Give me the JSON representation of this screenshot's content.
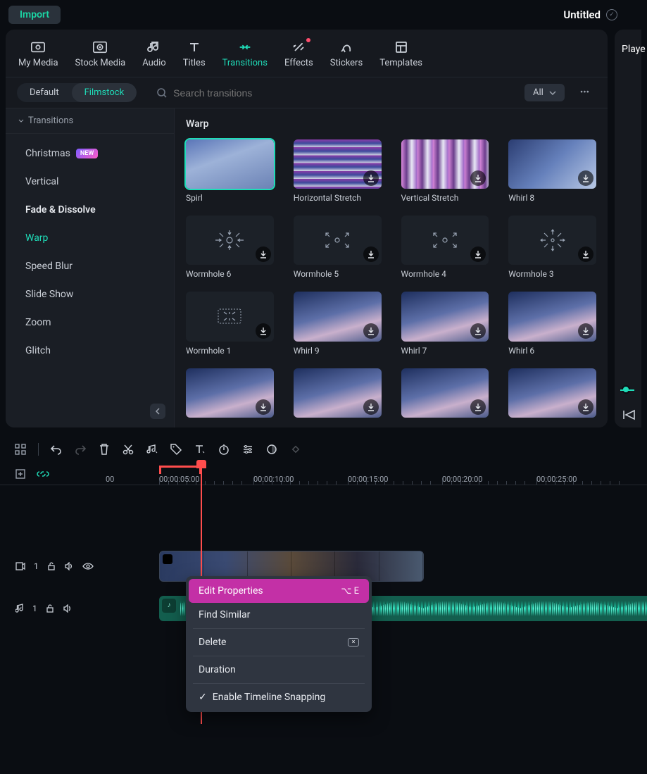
{
  "topbar": {
    "import_label": "Import",
    "project_title": "Untitled"
  },
  "tabs": {
    "my_media": "My Media",
    "stock_media": "Stock Media",
    "audio": "Audio",
    "titles": "Titles",
    "transitions": "Transitions",
    "effects": "Effects",
    "stickers": "Stickers",
    "templates": "Templates"
  },
  "subheader": {
    "toggle_default": "Default",
    "toggle_filmstock": "Filmstock",
    "search_placeholder": "Search transitions",
    "filter_label": "All"
  },
  "sidebar": {
    "header": "Transitions",
    "items": [
      {
        "label": "Christmas",
        "new": true
      },
      {
        "label": "Vertical"
      },
      {
        "label": "Fade & Dissolve",
        "bold": true
      },
      {
        "label": "Warp",
        "active": true
      },
      {
        "label": "Speed Blur"
      },
      {
        "label": "Slide Show"
      },
      {
        "label": "Zoom"
      },
      {
        "label": "Glitch"
      }
    ]
  },
  "grid": {
    "section": "Warp",
    "items": [
      {
        "label": "Spirl",
        "selected": true,
        "style": "sky1",
        "dl": false
      },
      {
        "label": "Horizontal Stretch",
        "style": "hstretch",
        "dl": true
      },
      {
        "label": "Vertical Stretch",
        "style": "vstretch",
        "dl": true
      },
      {
        "label": "Whirl 8",
        "style": "whirl",
        "dl": true
      },
      {
        "label": "Wormhole 6",
        "style": "wormhole",
        "pattern": "in",
        "dl": true
      },
      {
        "label": "Wormhole 5",
        "style": "wormhole",
        "pattern": "out-scatter",
        "dl": true
      },
      {
        "label": "Wormhole 4",
        "style": "wormhole",
        "pattern": "out-scatter",
        "dl": true
      },
      {
        "label": "Wormhole 3",
        "style": "wormhole",
        "pattern": "radial",
        "dl": true
      },
      {
        "label": "Wormhole 1",
        "style": "wormhole",
        "pattern": "diag",
        "dl": true
      },
      {
        "label": "Whirl 9",
        "style": "sky2",
        "dl": true
      },
      {
        "label": "Whirl 7",
        "style": "sky2",
        "dl": true
      },
      {
        "label": "Whirl 6",
        "style": "sky2",
        "dl": true
      },
      {
        "label": "",
        "style": "sky2",
        "dl": true
      },
      {
        "label": "",
        "style": "sky2",
        "dl": true
      },
      {
        "label": "",
        "style": "sky2",
        "dl": true
      },
      {
        "label": "",
        "style": "sky2",
        "dl": true
      }
    ]
  },
  "player": {
    "title": "Playe"
  },
  "ruler": {
    "labels": [
      "00",
      "00:00:05:00",
      "00:00:10:00",
      "00:00:15:00",
      "00:00:20:00",
      "00:00:25:00"
    ]
  },
  "tracks": {
    "video_num": "1",
    "audio_num": "1"
  },
  "ctx": {
    "edit_properties": "Edit Properties",
    "edit_shortcut": "⌥ E",
    "find_similar": "Find Similar",
    "delete": "Delete",
    "duration": "Duration",
    "snapping": "Enable Timeline Snapping"
  }
}
